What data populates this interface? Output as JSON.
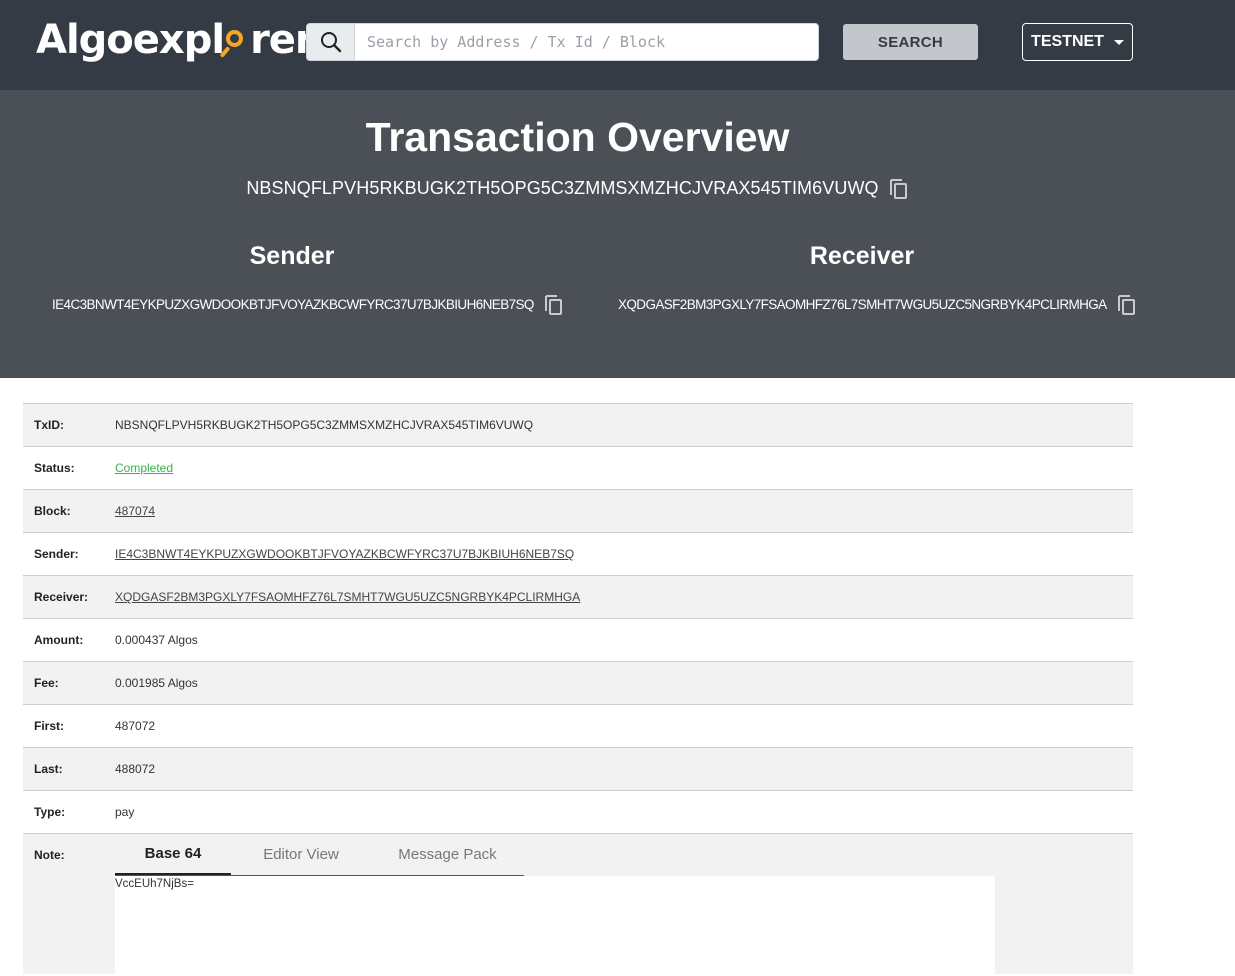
{
  "navbar": {
    "logo_text_before": "Algoexpl",
    "logo_text_after": "rer",
    "search_placeholder": "Search by Address / Tx Id / Block",
    "search_button": "SEARCH",
    "network_button": "TESTNET"
  },
  "hero": {
    "title": "Transaction Overview",
    "txid": "NBSNQFLPVH5RKBUGK2TH5OPG5C3ZMMSXMZHCJVRAX545TIM6VUWQ",
    "sender_heading": "Sender",
    "sender_address": "IE4C3BNWT4EYKPUZXGWDOOKBTJFVOYAZKBCWFYRC37U7BJKBIUH6NEB7SQ",
    "receiver_heading": "Receiver",
    "receiver_address": "XQDGASF2BM3PGXLY7FSAOMHFZ76L7SMHT7WGU5UZC5NGRBYK4PCLIRMHGA"
  },
  "details": {
    "txid_label": "TxID:",
    "txid_value": "NBSNQFLPVH5RKBUGK2TH5OPG5C3ZMMSXMZHCJVRAX545TIM6VUWQ",
    "status_label": "Status:",
    "status_value": "Completed",
    "block_label": "Block:",
    "block_value": "487074",
    "sender_label": "Sender:",
    "sender_value": "IE4C3BNWT4EYKPUZXGWDOOKBTJFVOYAZKBCWFYRC37U7BJKBIUH6NEB7SQ",
    "receiver_label": "Receiver:",
    "receiver_value": "XQDGASF2BM3PGXLY7FSAOMHFZ76L7SMHT7WGU5UZC5NGRBYK4PCLIRMHGA",
    "amount_label": "Amount:",
    "amount_value": "0.000437 Algos",
    "fee_label": "Fee:",
    "fee_value": "0.001985 Algos",
    "first_label": "First:",
    "first_value": "487072",
    "last_label": "Last:",
    "last_value": "488072",
    "type_label": "Type:",
    "type_value": "pay",
    "note_label": "Note:"
  },
  "note": {
    "tabs": [
      "Base 64",
      "Editor View",
      "Message Pack"
    ],
    "active_tab": "Base 64",
    "content": "VccEUh7NjBs="
  },
  "colors": {
    "navbar_bg": "#353b45",
    "hero_bg": "#4b4f56",
    "logo_accent": "#f5a623",
    "status_green": "#38b44a"
  },
  "icons": {
    "search": "magnifier-icon",
    "copy": "copy-icon",
    "dropdown": "caret-down-icon"
  }
}
